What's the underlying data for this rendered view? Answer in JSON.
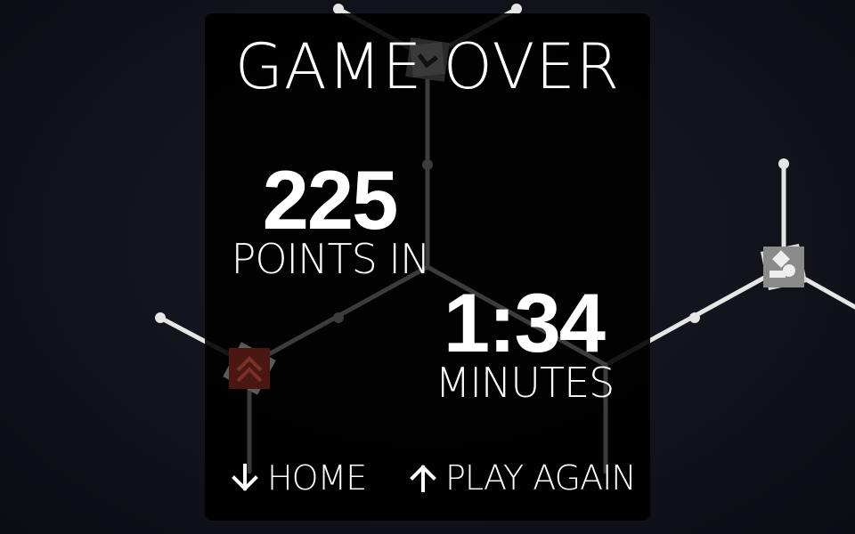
{
  "game_over": {
    "title": "GAME OVER",
    "score": "225",
    "score_caption": "POINTS IN",
    "time": "1:34",
    "time_caption": "MINUTES"
  },
  "actions": {
    "home_label": "HOME",
    "home_icon": "arrow-down-icon",
    "play_again_label": "PLAY AGAIN",
    "play_again_icon": "arrow-up-icon"
  },
  "colors": {
    "background": "#12121b",
    "panel": "#000000",
    "text": "#ffffff",
    "path_dim": "#3c3c3c",
    "path_bright": "#e6e6e6",
    "tile_red": "#4a1712",
    "tile_grey": "#8a8a8a"
  },
  "tiles": [
    {
      "name": "tile-dark-chevron",
      "icon": "chevron-down-icon"
    },
    {
      "name": "tile-red-chevrons",
      "icon": "double-chevron-up-icon"
    },
    {
      "name": "tile-grey-shapes",
      "icon": "diamond-icon"
    }
  ]
}
